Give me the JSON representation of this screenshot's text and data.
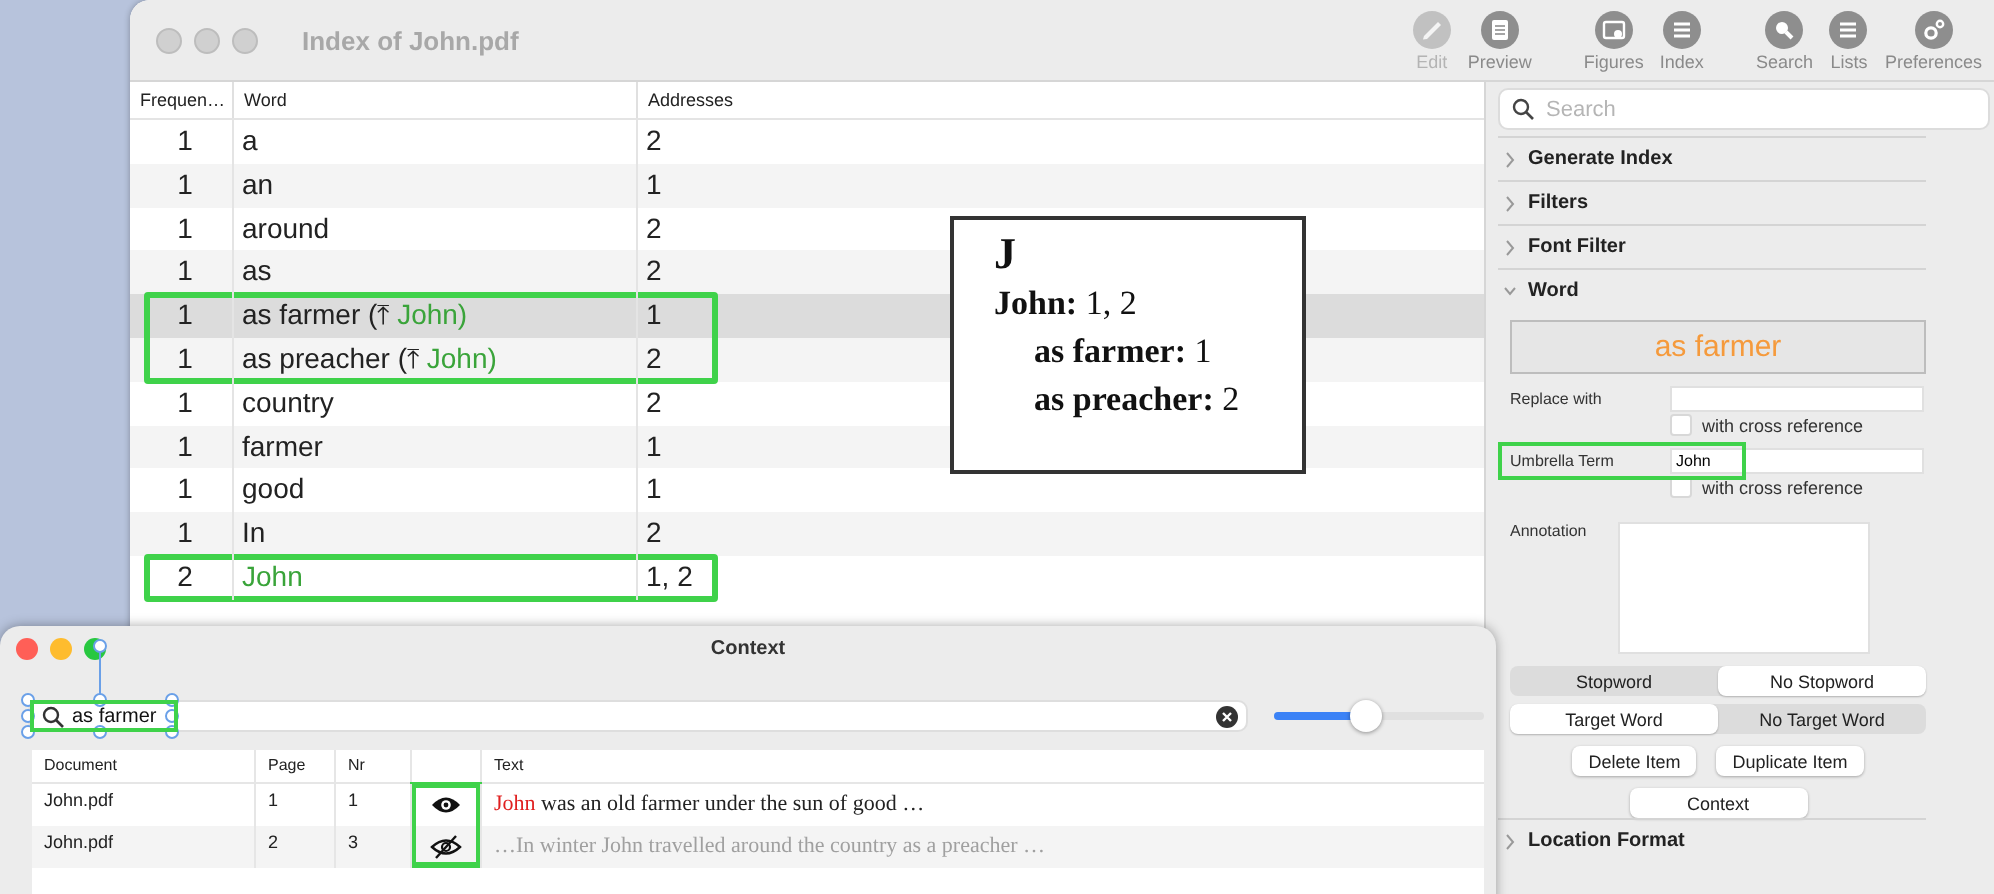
{
  "main_window": {
    "title": "Index of John.pdf",
    "toolbar": [
      {
        "label": "Edit",
        "kind": "pencil",
        "disabled": true
      },
      {
        "label": "Preview",
        "kind": "document",
        "disabled": false
      },
      {
        "label": "Figures",
        "kind": "figures",
        "disabled": false
      },
      {
        "label": "Index",
        "kind": "list",
        "disabled": false
      },
      {
        "label": "Search",
        "kind": "search",
        "disabled": false
      },
      {
        "label": "Lists",
        "kind": "list",
        "disabled": false
      },
      {
        "label": "Preferences",
        "kind": "gear",
        "disabled": false
      }
    ],
    "word_table": {
      "columns": [
        "Frequen…",
        "Word",
        "Addresses"
      ],
      "rows": [
        {
          "frequency": "1",
          "word": "a",
          "addresses": "2",
          "kind": "plain",
          "selected": false,
          "marked": false
        },
        {
          "frequency": "1",
          "word": "an",
          "addresses": "1",
          "kind": "plain",
          "selected": false,
          "marked": false
        },
        {
          "frequency": "1",
          "word": "around",
          "addresses": "2",
          "kind": "plain",
          "selected": false,
          "marked": false
        },
        {
          "frequency": "1",
          "word": "as",
          "addresses": "2",
          "kind": "plain",
          "selected": false,
          "marked": false
        },
        {
          "frequency": "1",
          "word": "as farmer (⤒ ",
          "umbrella": "John)",
          "addresses": "1",
          "kind": "plain",
          "selected": true,
          "marked": true
        },
        {
          "frequency": "1",
          "word": "as preacher (⤒ ",
          "umbrella": "John)",
          "addresses": "2",
          "kind": "plain",
          "selected": false,
          "marked": true
        },
        {
          "frequency": "1",
          "word": "country",
          "addresses": "2",
          "kind": "plain",
          "selected": false,
          "marked": false
        },
        {
          "frequency": "1",
          "word": "farmer",
          "addresses": "1",
          "kind": "plain",
          "selected": false,
          "marked": false
        },
        {
          "frequency": "1",
          "word": "good",
          "addresses": "1",
          "kind": "plain",
          "selected": false,
          "marked": false
        },
        {
          "frequency": "1",
          "word": "In",
          "addresses": "2",
          "kind": "plain",
          "selected": false,
          "marked": false
        },
        {
          "frequency": "2",
          "word": "John",
          "addresses": "1, 2",
          "kind": "umbrella",
          "selected": false,
          "marked": true
        }
      ]
    },
    "index_preview": {
      "letter": "J",
      "entries": [
        {
          "text": "**John:** 1, 2",
          "children": [
            "**as farmer:** 1",
            "**as preacher:** 2"
          ]
        }
      ]
    },
    "sidebar": {
      "search": {
        "placeholder": "Search"
      },
      "sections": [
        {
          "title": "Generate Index",
          "expanded": false
        },
        {
          "title": "Filters",
          "expanded": false
        },
        {
          "title": "Font Filter",
          "expanded": false
        },
        {
          "title": "Word",
          "expanded": true,
          "panel": {
            "term": "as farmer",
            "replace": {
              "label": "Replace with",
              "cross_reference": {
                "label": "with cross reference",
                "checked": false
              }
            },
            "umbrella": {
              "label": "Umbrella Term",
              "value": "John",
              "marked": true,
              "cross_reference": {
                "label": "with cross reference",
                "checked": false
              }
            },
            "annotation": {
              "label": "Annotation"
            },
            "stopword": [
              {
                "label": "Stopword",
                "selected": false
              },
              {
                "label": "No Stopword",
                "selected": true
              }
            ],
            "target": [
              {
                "label": "Target Word",
                "selected": true
              },
              {
                "label": "No Target Word",
                "selected": false
              }
            ],
            "actions": [
              "Delete Item",
              "Duplicate Item"
            ],
            "context_button": "Context"
          }
        },
        {
          "title": "Location Format",
          "expanded": false
        }
      ]
    }
  },
  "context_window": {
    "title": "Context",
    "search": {
      "value": "as farmer",
      "marked": true
    },
    "slider": {
      "level": 0.44
    },
    "table": {
      "columns": [
        "Document",
        "Page",
        "Nr",
        "Text"
      ],
      "rows": [
        {
          "document": "John.pdf",
          "page": "1",
          "nr": "1",
          "visible": true,
          "marked": true,
          "match": "John",
          "text": " was an old farmer under the sun of good …"
        },
        {
          "document": "John.pdf",
          "page": "2",
          "nr": "3",
          "visible": false,
          "marked": true,
          "text": "…In winter  John travelled around the country as a preacher …"
        }
      ]
    }
  }
}
